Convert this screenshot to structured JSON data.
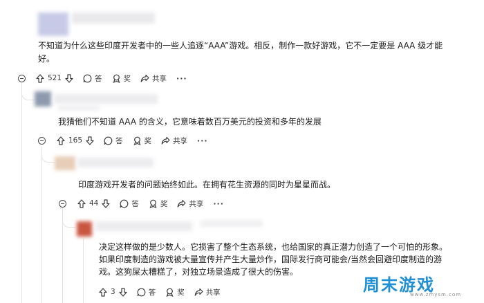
{
  "comments": [
    {
      "text_line1": "不知道为什么这些印度开发者中的一些人追逐“AAA”游戏。相反，制作一款好游戏，它不一定要是 AAA 级才能",
      "text_line2": "好。",
      "votes": "521",
      "reply_label": "答",
      "award_label": "奖",
      "share_label": "共享",
      "more_label": "···"
    },
    {
      "text_line1": "我猜他们不知道 AAA 的含义，它意味着数百万美元的投资和多年的发展",
      "votes": "165",
      "reply_label": "答",
      "award_label": "奖",
      "share_label": "共享",
      "more_label": "···"
    },
    {
      "text_line1": "印度游戏开发者的问题始终如此。在拥有花生资源的同时为星星而战。",
      "votes": "44",
      "reply_label": "答",
      "award_label": "奖",
      "share_label": "共享",
      "more_label": "···"
    },
    {
      "text_line1": "决定这样做的是少数人。它损害了整个生态系统，也给国家的真正潜力创造了一个可怕的形象。",
      "text_line2": "如果印度制造的游戏被大量宣传并产生大量炒作，国际发行商可能会/当然会回避印度制造的游",
      "text_line3": "戏。这狗屎太糟糕了，对独立场景造成了很大的伤害。",
      "votes": "3",
      "reply_label": "答",
      "award_label": "奖",
      "share_label": "共享"
    }
  ],
  "watermark": {
    "main": "周末游戏",
    "sub": "www.zmysm.com"
  },
  "colors": {
    "text": "#1c1c1c",
    "meta": "#3b3b3b",
    "thread": "#e3e3e3",
    "watermark": "#1f8fd6"
  }
}
